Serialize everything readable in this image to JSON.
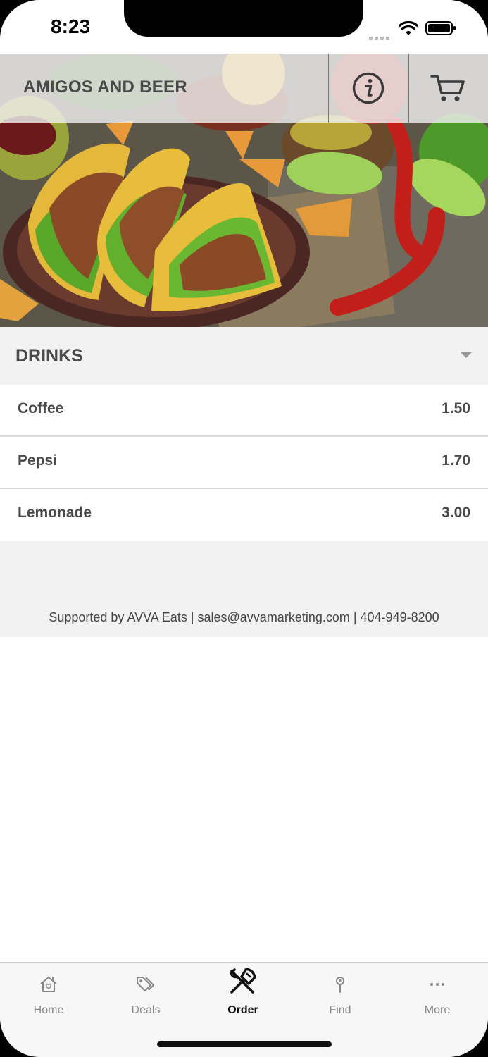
{
  "status_bar": {
    "time": "8:23"
  },
  "header": {
    "title": "AMIGOS AND BEER",
    "info_icon": "info-icon",
    "cart_icon": "cart-icon"
  },
  "menu": {
    "category": "DRINKS",
    "items": [
      {
        "name": "Coffee",
        "price": "1.50"
      },
      {
        "name": "Pepsi",
        "price": "1.70"
      },
      {
        "name": "Lemonade",
        "price": "3.00"
      }
    ]
  },
  "footer": {
    "text": "Supported by AVVA Eats | sales@avvamarketing.com | 404-949-8200"
  },
  "tabs": [
    {
      "label": "Home",
      "icon": "home-icon"
    },
    {
      "label": "Deals",
      "icon": "tag-icon"
    },
    {
      "label": "Order",
      "icon": "utensils-icon",
      "active": true
    },
    {
      "label": "Find",
      "icon": "location-pin-icon"
    },
    {
      "label": "More",
      "icon": "more-icon"
    }
  ],
  "colors": {
    "header_text": "#4a4a4a",
    "section_bg": "#f2f2f2",
    "active_tab": "#111111",
    "inactive_tab": "#888888"
  }
}
